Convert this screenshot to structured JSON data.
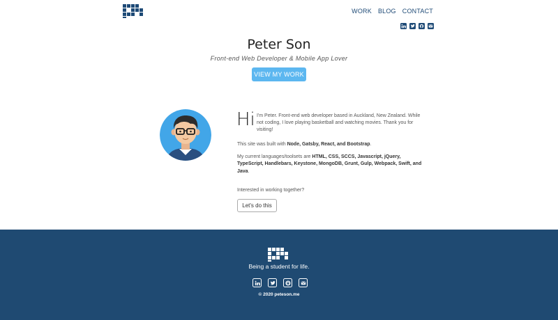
{
  "brand": {
    "accent": "#1e4a76",
    "button_color": "#5cb7f0",
    "footer_bg": "#1f4a72"
  },
  "nav": {
    "items": [
      {
        "label": "WORK"
      },
      {
        "label": "BLOG"
      },
      {
        "label": "CONTACT"
      }
    ],
    "social_icons": [
      "linkedin-icon",
      "twitter-icon",
      "github-icon",
      "email-icon"
    ]
  },
  "hero": {
    "name": "Peter Son",
    "subtitle": "Front-end Web Developer & Mobile App Lover",
    "button_label": "VIEW MY WORK"
  },
  "about": {
    "greeting": "Hi",
    "intro": "I'm Peter. Front-end web developer based in Auckland, New Zealand. While not coding, I love playing basketball and watching movies. Thank you for visiting!",
    "built_prefix": "This site was built with ",
    "built_with": "Node, Gatsby, React, and Bootstrap",
    "built_suffix": ".",
    "tools_prefix": "My current languages/toolsets are ",
    "tools": "HTML, CSS, SCCS, Javascript, jQuery, TypeScript, Handlebars, Keystone, MongoDB, Grunt, Gulp, Webpack, Swift, and Java",
    "tools_suffix": ".",
    "question": "Interested in working together?",
    "cta_label": "Let's do this"
  },
  "footer": {
    "tagline": "Being a student for life.",
    "social_icons": [
      "linkedin-icon",
      "twitter-icon",
      "github-icon",
      "email-icon"
    ],
    "copyright": "© 2020 peteson.me"
  }
}
